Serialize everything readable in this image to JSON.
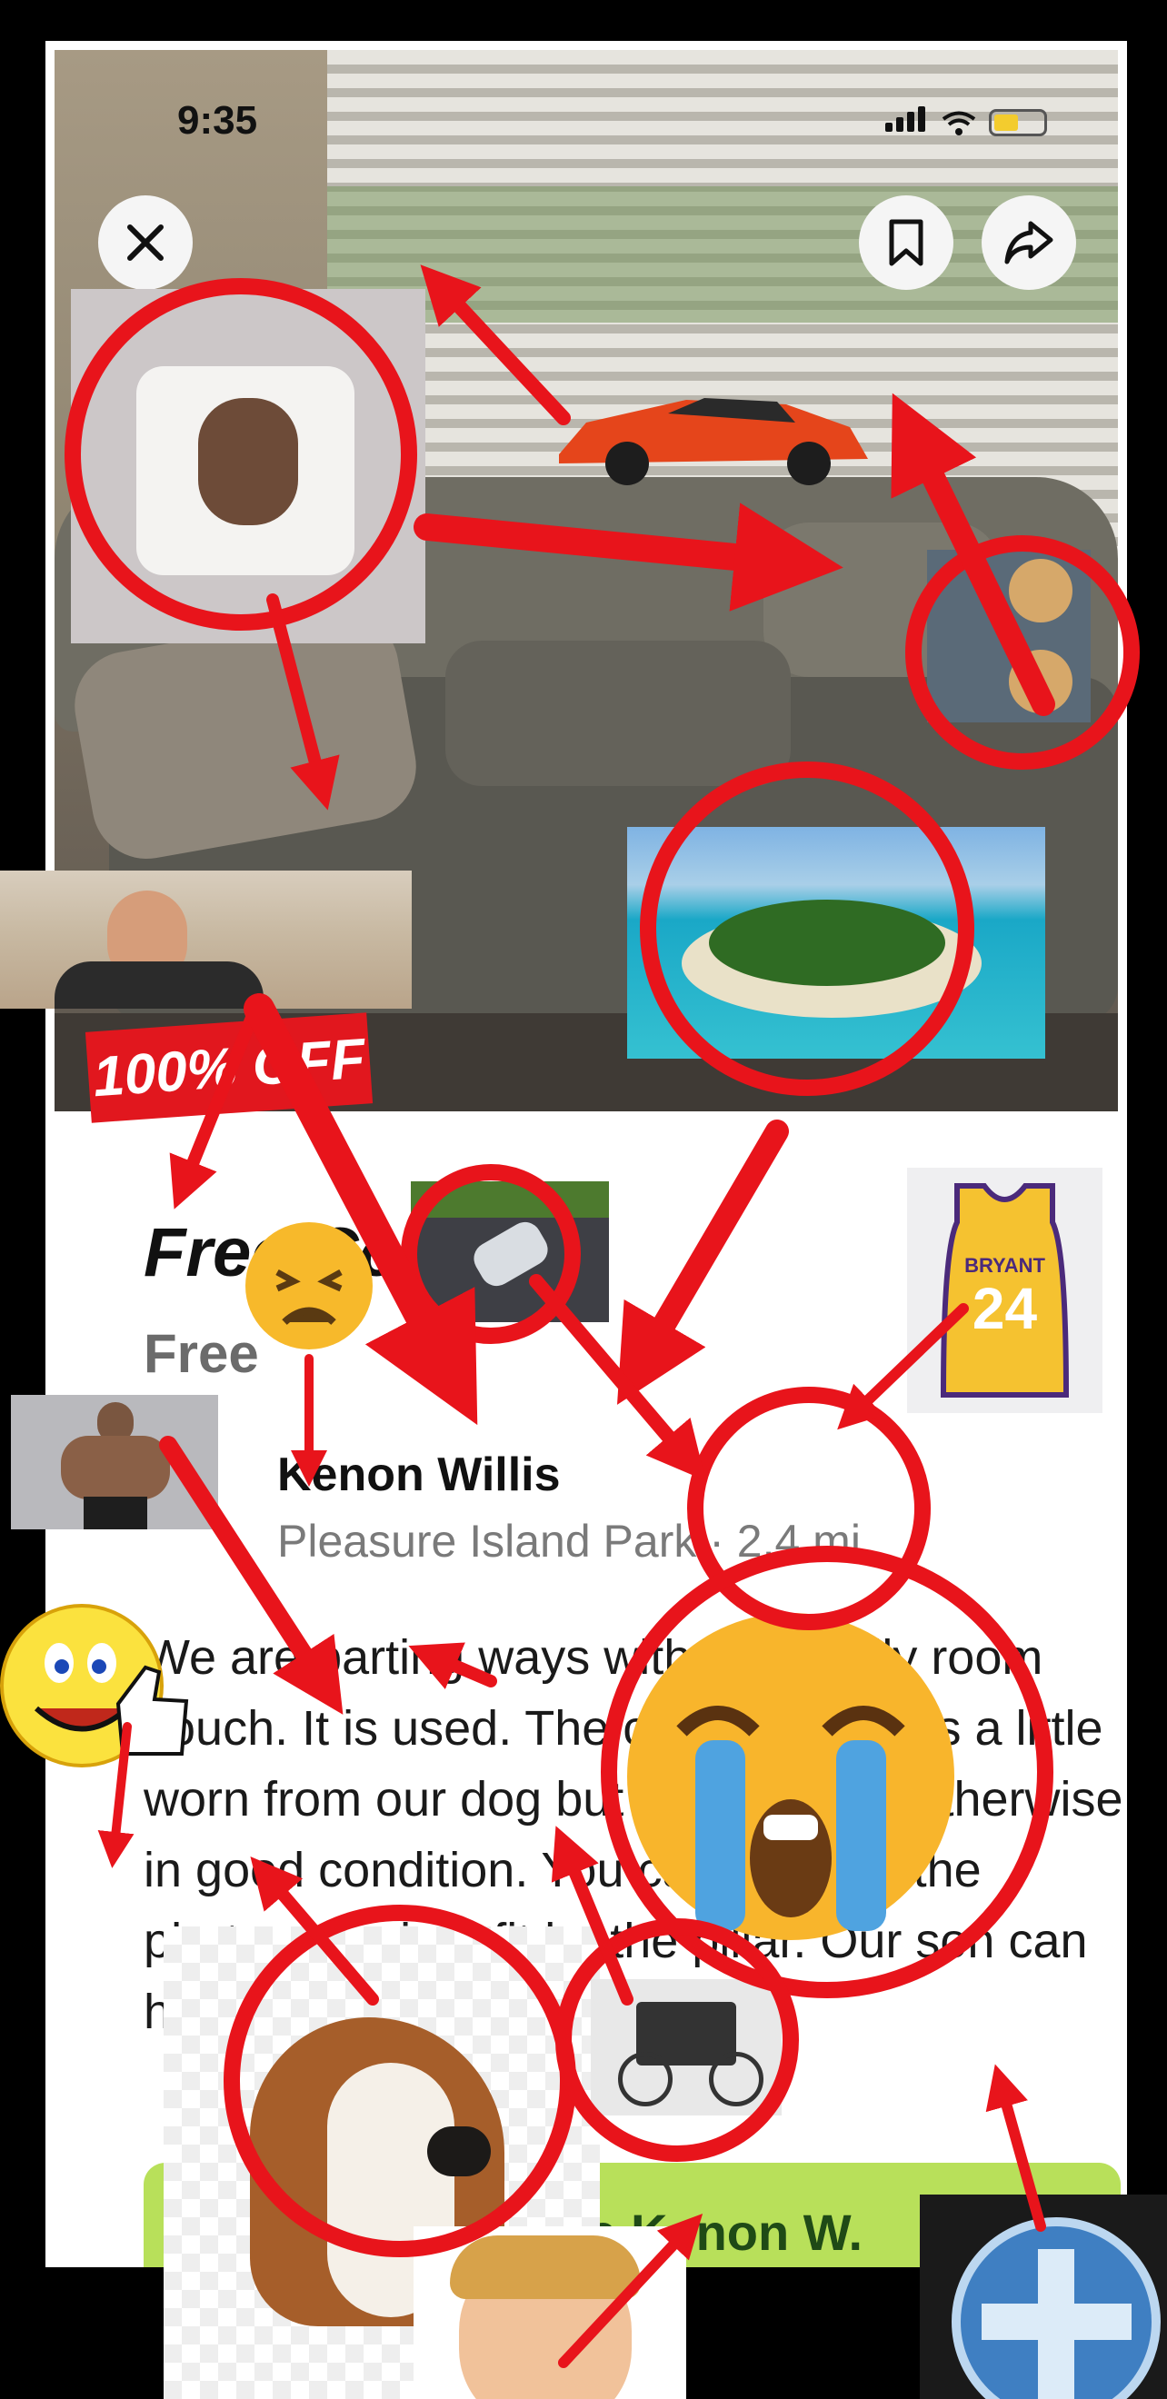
{
  "status_bar": {
    "time": "9:35"
  },
  "listing": {
    "title": "Free Couch",
    "price": "Free",
    "seller_name": "Kenon Willis",
    "seller_location": "Pleasure Island Park · 2.4 mi",
    "description": "We are parting ways with our family room couch. It is used. The cushion-back is a little worn from our dog but the couch is otherwise in good condition. You can see it in the photos. It might fit by the pillar. Our son can help",
    "cta_label": "Message Kenon W."
  },
  "stickers": {
    "discount": "100% OFF",
    "jersey_name": "BRYANT",
    "jersey_number": "24"
  },
  "icons": [
    "close-icon",
    "bookmark-icon",
    "share-icon",
    "signal-icon",
    "wifi-icon",
    "battery-icon",
    "plus-icon"
  ],
  "colors": {
    "annotation_red": "#e8141b",
    "cta_green": "#b8e05a",
    "cta_text": "#1f4a16"
  }
}
